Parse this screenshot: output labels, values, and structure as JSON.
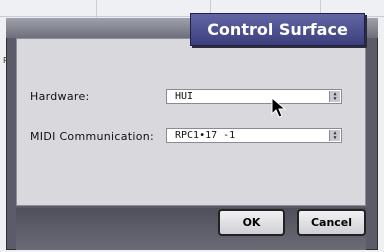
{
  "dialog": {
    "title": "Control Surface"
  },
  "fields": [
    {
      "label": "Hardware:",
      "value": "HUI"
    },
    {
      "label": "MIDI Communication:",
      "value": "RPC1•17 -1"
    }
  ],
  "buttons": {
    "ok": "OK",
    "cancel": "Cancel"
  },
  "background": {
    "stub_text": "Pa"
  },
  "colors": {
    "title_tab": "#4a4d8c",
    "dialog_frame": "#5b5c67",
    "panel": "#d9d8dc"
  }
}
